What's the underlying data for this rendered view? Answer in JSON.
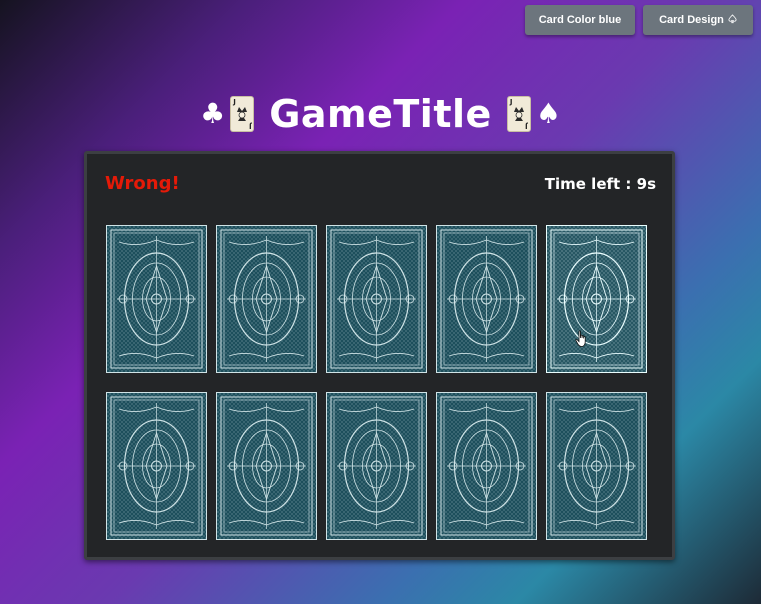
{
  "toolbar": {
    "card_color_label": "Card Color blue",
    "card_design_label": "Card Design",
    "card_design_icon": "spade-outline-icon"
  },
  "title": {
    "text": "GameTitle",
    "left_suit": "♣",
    "right_suit": "♠",
    "jester_letter": "J"
  },
  "game": {
    "status": "Wrong!",
    "timer": "Time left : 9s",
    "status_color": "#e51a08"
  },
  "cards": [
    {
      "face": "down"
    },
    {
      "face": "down"
    },
    {
      "face": "down"
    },
    {
      "face": "down"
    },
    {
      "face": "down"
    },
    {
      "face": "down"
    },
    {
      "face": "down"
    },
    {
      "face": "down"
    },
    {
      "face": "down"
    },
    {
      "face": "down"
    }
  ],
  "colors": {
    "card_back": "#1d4f5c",
    "card_pattern": "#cfe3e6",
    "board": "#232527"
  }
}
